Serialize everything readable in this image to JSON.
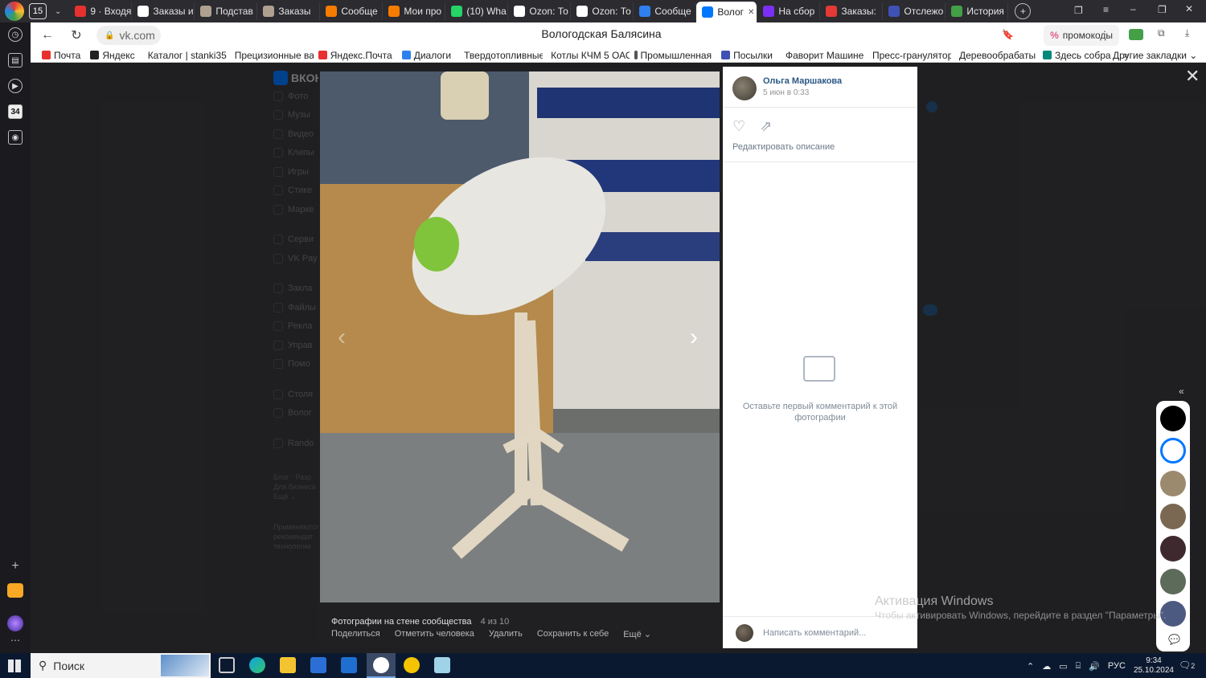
{
  "browser": {
    "tab_count": "15",
    "tabs": [
      {
        "label": "9 · Входя",
        "color": "#e8312f"
      },
      {
        "label": "Заказы и",
        "color": "#ffffff"
      },
      {
        "label": "Подстав",
        "color": "#b0a090"
      },
      {
        "label": "Заказы",
        "color": "#b0a090"
      },
      {
        "label": "Сообще",
        "color": "#f57c00"
      },
      {
        "label": "Мои про",
        "color": "#f57c00"
      },
      {
        "label": "(10) Wha",
        "color": "#25d366"
      },
      {
        "label": "Ozon: То",
        "color": "#ffffff"
      },
      {
        "label": "Ozon: То",
        "color": "#ffffff"
      },
      {
        "label": "Сообще",
        "color": "#2f80ed"
      },
      {
        "label": "Волог",
        "color": "#0077ff",
        "active": true
      },
      {
        "label": "На сбор",
        "color": "#7b2ff7"
      },
      {
        "label": "Заказы: ",
        "color": "#e53935"
      },
      {
        "label": "Отслежо",
        "color": "#3f51b5"
      },
      {
        "label": "История",
        "color": "#43a047"
      }
    ],
    "url": "vk.com",
    "page_title": "Вологодская Балясина",
    "promo_label": "промокоды",
    "bookmarks": [
      {
        "label": "Почта",
        "color": "#e8312f"
      },
      {
        "label": "Яндекс",
        "color": "#222222"
      },
      {
        "label": "Каталог | stanki35",
        "color": "#c62828"
      },
      {
        "label": "Прецизионные ва",
        "color": "#1565c0"
      },
      {
        "label": "Яндекс.Почта",
        "color": "#e8312f"
      },
      {
        "label": "Диалоги",
        "color": "#2f80ed"
      },
      {
        "label": "Твердотопливные",
        "color": "#c62828"
      },
      {
        "label": "Котлы КЧМ 5 ОАО",
        "color": "#d32f2f"
      },
      {
        "label": "Промышленная ",
        "color": "#555555"
      },
      {
        "label": "Посылки",
        "color": "#3f51b5"
      },
      {
        "label": "Фаворит Машине",
        "color": "#d32f2f"
      },
      {
        "label": "Пресс-гранулятор",
        "color": "#555555"
      },
      {
        "label": "Деревообрабаты",
        "color": "#2e7d32"
      },
      {
        "label": "Здесь собра",
        "color": "#00897b"
      }
    ],
    "bookmarks_more": "»",
    "other_bookmarks": "Другие закладки"
  },
  "vk_menu": [
    "Фото",
    "Музы",
    "Видео",
    "Клипы",
    "Игры",
    "Стике",
    "Марке",
    "Серви",
    "VK Pay",
    "Закла",
    "Файлы",
    "Рекла",
    "Управ",
    "Помо",
    "Столя",
    "Волог",
    "Rando"
  ],
  "vk_footer": [
    "Блог · Разр",
    "Для бизнеса",
    "Ещё ⌄",
    "Применяются",
    "рекомендат",
    "технологии"
  ],
  "viewer": {
    "author_name": "Ольга Маршакова",
    "date": "5 июн в 0:33",
    "edit_description": "Редактировать описание",
    "empty_comments": "Оставьте первый комментарий к этой фотографии",
    "comment_placeholder": "Написать комментарий...",
    "album": "Фотографии на стене сообщества",
    "counter": "4 из 10",
    "actions": [
      "Поделиться",
      "Отметить человека",
      "Удалить",
      "Сохранить к себе",
      "Ещё ⌄"
    ]
  },
  "windows": {
    "activation_title": "Активация Windows",
    "activation_text": "Чтобы активировать Windows, перейдите в раздел \"Параметры\".",
    "search_label": "Поиск",
    "time": "9:34",
    "date": "25.10.2024",
    "lang": "РУС",
    "notifications": "2"
  }
}
